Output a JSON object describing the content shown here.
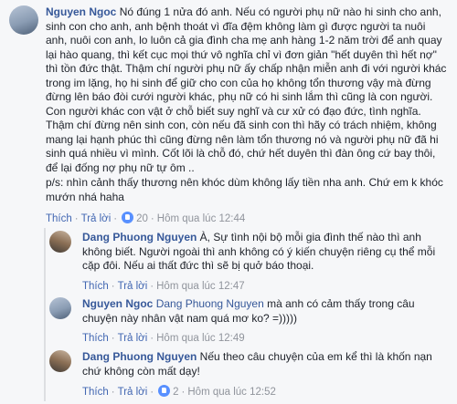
{
  "comments": [
    {
      "author": "Nguyen Ngoc",
      "text": "Nó đúng 1 nửa đó anh. Nếu có người phụ nữ nào hi sinh cho anh, sinh con cho anh, anh bệnh thoát vì đĩa đệm không làm gì được người ta nuôi anh, nuôi con anh, lo luôn cả gia đình cha mẹ anh hàng 1-2 năm trời để anh quay lại hào quang, thì kết cục mọi thứ vô nghĩa chỉ vì đơn giản \"hết duyên thì hết nợ\" thì tồn đức thật. Thậm chí người phụ nữ ấy chấp nhận miễn anh đi với người khác trong im lặng, họ hi sinh để giữ cho con của họ không tổn thương vậy mà đừng đừng lên báo đòi cưới người khác, phụ nữ có hi sinh lắm thì cũng là con người. Con người khác con vật ở chỗ biết suy nghĩ và cư xử có đạo đức, tình nghĩa. Thậm chí đừng nên sinh con, còn nếu đã sinh con thì hãy có trách nhiệm, không mang lại hạnh phúc thì cũng đừng nên làm tổn thương nó và người phụ nữ đã hi sinh quá nhiều vì mình. Cốt lõi là chỗ đó, chứ hết duyên thì đàn ông cứ bay thôi, để lại đống nợ phụ nữ tự ôm ..",
      "ps": "p/s: nhìn cảnh thấy thương nên khóc dùm không lấy tiền nha anh. Chứ em k khóc mướn nhá haha",
      "like": "Thích",
      "reply": "Trả lời",
      "reactions": "20",
      "time": "Hôm qua lúc 12:44"
    },
    {
      "author": "Dang Phuong Nguyen",
      "text": "À, Sự tình nội bộ mỗi gia đình thế nào thì anh không biết. Người ngoài thì anh không có ý kiến chuyện riêng cụ thể mỗi cặp đôi. Nếu ai thất đức thì sẽ bị quở báo thoại.",
      "like": "Thích",
      "reply": "Trả lời",
      "time": "Hôm qua lúc 12:47"
    },
    {
      "author": "Nguyen Ngoc",
      "tag": "Dang Phuong Nguyen",
      "text": "mà anh có cảm thấy trong câu chuyện này nhân vật nam quá mơ ko? =)))))",
      "like": "Thích",
      "reply": "Trả lời",
      "time": "Hôm qua lúc 12:49"
    },
    {
      "author": "Dang Phuong Nguyen",
      "text": "Nếu theo câu chuyện của em kể thì là khốn nạn chứ không còn mất dạy!",
      "like": "Thích",
      "reply": "Trả lời",
      "reactions": "2",
      "time": "Hôm qua lúc 12:52"
    }
  ]
}
